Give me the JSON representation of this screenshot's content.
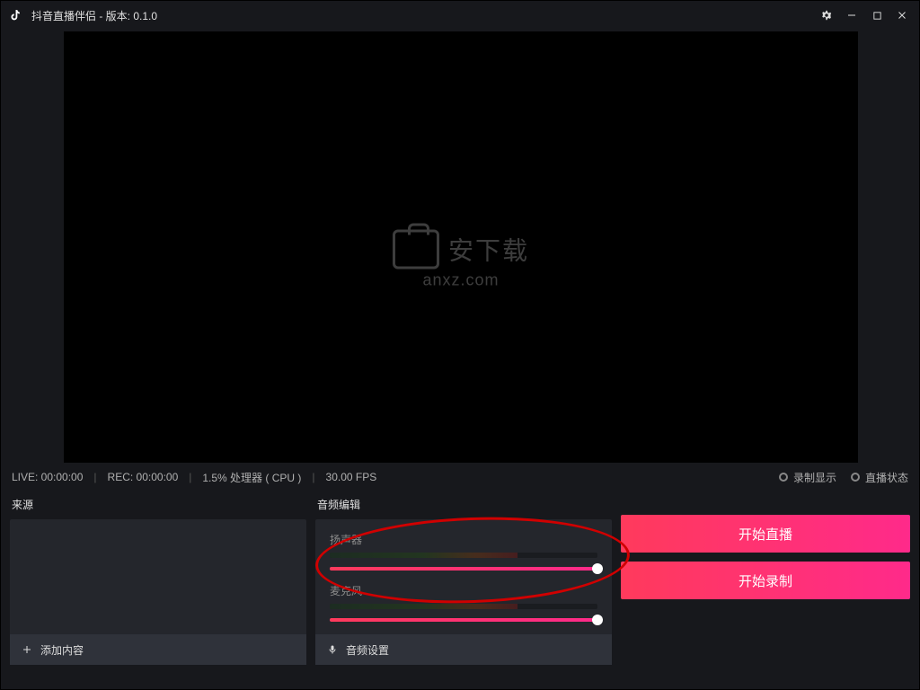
{
  "titlebar": {
    "app_title": "抖音直播伴侣 - 版本: 0.1.0"
  },
  "watermark": {
    "line1": "安下载",
    "line2": "anxz.com"
  },
  "statusbar": {
    "live": "LIVE: 00:00:00",
    "rec": "REC: 00:00:00",
    "cpu": "1.5% 处理器 ( CPU )",
    "fps": "30.00 FPS",
    "rec_indicator": "录制显示",
    "live_indicator": "直播状态"
  },
  "sources": {
    "title": "来源",
    "add_label": "添加内容"
  },
  "audio": {
    "title": "音频编辑",
    "speaker_label": "扬声器",
    "mic_label": "麦克风",
    "settings_label": "音频设置"
  },
  "actions": {
    "start_live": "开始直播",
    "start_record": "开始录制"
  }
}
